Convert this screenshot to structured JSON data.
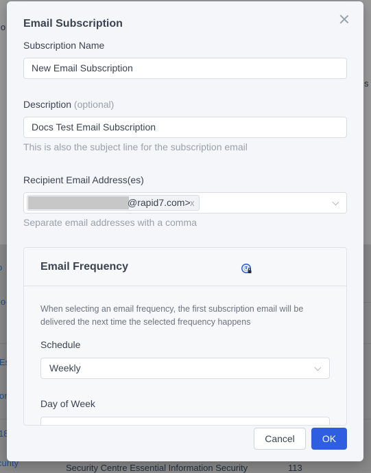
{
  "background": {
    "left_fragments": [
      "io",
      "o",
      "lo",
      "Es",
      "on",
      "18",
      "curity"
    ],
    "right_fragment": "s",
    "bottom_row": {
      "name": "Security Centre Essential Information Security",
      "count": "113"
    }
  },
  "modal": {
    "title": "Email Subscription",
    "close_icon": "close-icon",
    "subscription_name": {
      "label": "Subscription Name",
      "value": "New Email Subscription"
    },
    "description": {
      "label": "Description",
      "optional": "(optional)",
      "value": "Docs Test Email Subscription",
      "help": "This is also the subject line for the subscription email"
    },
    "recipients": {
      "label": "Recipient Email Address(es)",
      "tag_text": "@rapid7.com>",
      "tag_remove": "x",
      "help": "Separate email addresses with a comma"
    },
    "frequency": {
      "title": "Email Frequency",
      "info_icon": "info-icon",
      "description": "When selecting an email frequency, the first subscription email will be delivered the next time the selected frequency happens",
      "schedule": {
        "label": "Schedule",
        "value": "Weekly"
      },
      "day_of_week": {
        "label": "Day of Week",
        "value": ""
      }
    },
    "buttons": {
      "cancel": "Cancel",
      "ok": "OK"
    }
  },
  "colors": {
    "primary": "#2f5fe0",
    "modal_bg": "#f4f6f9",
    "text": "#3b4350",
    "muted": "#9aa1ab"
  }
}
